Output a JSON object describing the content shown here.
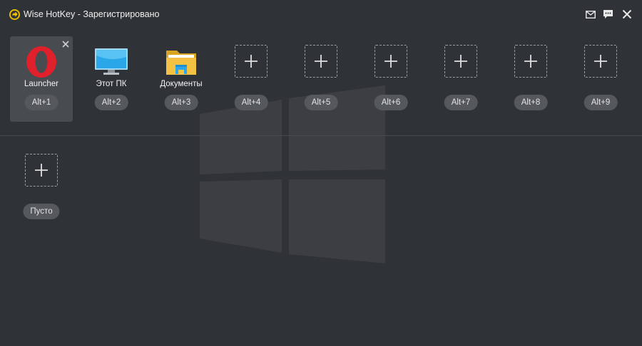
{
  "window": {
    "title": "Wise HotKey - Зарегистрировано"
  },
  "row1": [
    {
      "label": "Launcher",
      "key": "Alt+1",
      "icon": "opera-icon",
      "selected": true
    },
    {
      "label": "Этот ПК",
      "key": "Alt+2",
      "icon": "monitor-icon"
    },
    {
      "label": "Документы",
      "key": "Alt+3",
      "icon": "folder-icon"
    },
    {
      "label": "",
      "key": "Alt+4",
      "icon": "plus-icon"
    },
    {
      "label": "",
      "key": "Alt+5",
      "icon": "plus-icon"
    },
    {
      "label": "",
      "key": "Alt+6",
      "icon": "plus-icon"
    },
    {
      "label": "",
      "key": "Alt+7",
      "icon": "plus-icon"
    },
    {
      "label": "",
      "key": "Alt+8",
      "icon": "plus-icon"
    },
    {
      "label": "",
      "key": "Alt+9",
      "icon": "plus-icon"
    }
  ],
  "row2": [
    {
      "label": "",
      "key": "Пусто",
      "icon": "plus-icon"
    }
  ],
  "colors": {
    "background": "#2f3236",
    "selected": "#484b50",
    "keyBadge": "#55585c",
    "opera": "#e0202b",
    "folder": "#f4c242"
  }
}
